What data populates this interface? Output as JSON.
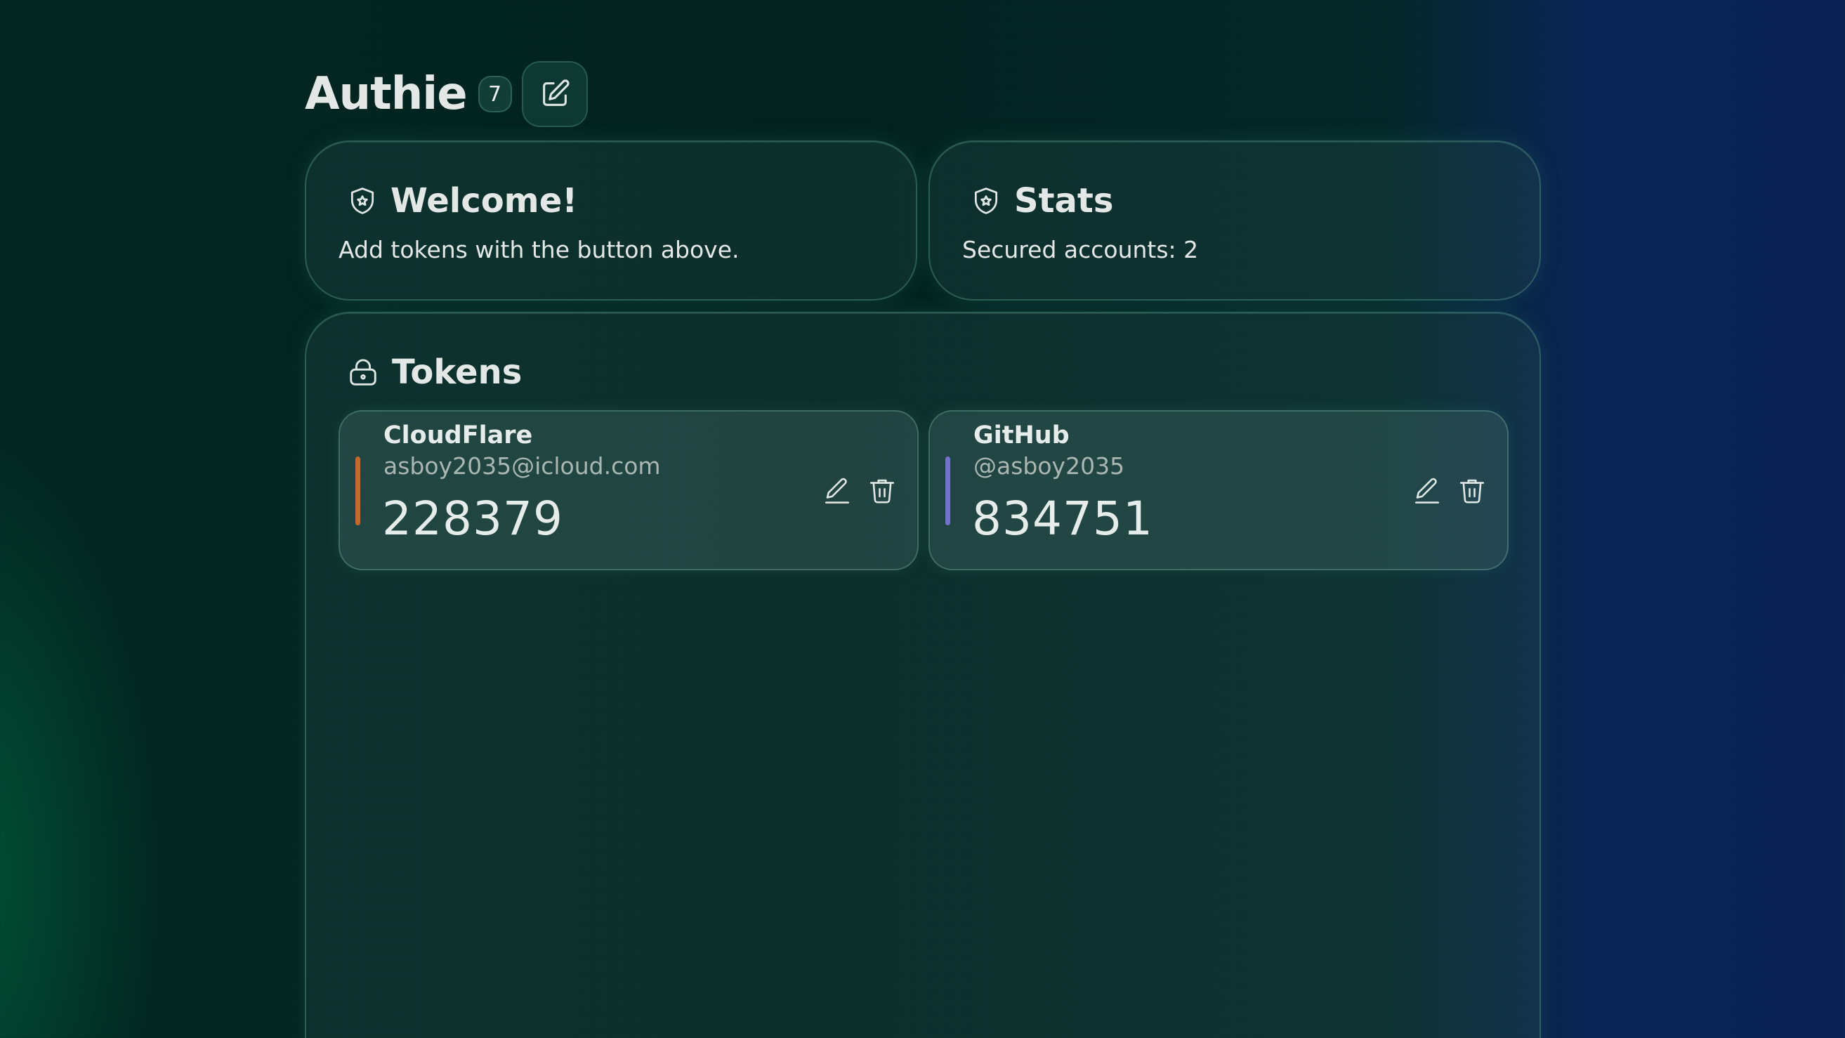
{
  "header": {
    "title": "Authie",
    "count": "7",
    "edit_icon": "edit-square-icon"
  },
  "welcome": {
    "icon": "shield-star-icon",
    "title": "Welcome!",
    "text": "Add tokens with the button above."
  },
  "stats": {
    "icon": "shield-star-icon",
    "title": "Stats",
    "text": "Secured accounts: 2"
  },
  "tokens": {
    "icon": "lock-icon",
    "title": "Tokens",
    "items": [
      {
        "name": "CloudFlare",
        "account": "asboy2035@icloud.com",
        "code": "228379",
        "accent_color": "#c9672a",
        "edit_icon": "pencil-icon",
        "delete_icon": "trash-icon"
      },
      {
        "name": "GitHub",
        "account": "@asboy2035",
        "code": "834751",
        "accent_color": "#7472cf",
        "edit_icon": "pencil-icon",
        "delete_icon": "trash-icon"
      }
    ]
  },
  "colors": {
    "text": "#e3e8e6",
    "muted_text": "#a9b6b2",
    "background_left": "#022722",
    "background_right": "#0a2255"
  }
}
